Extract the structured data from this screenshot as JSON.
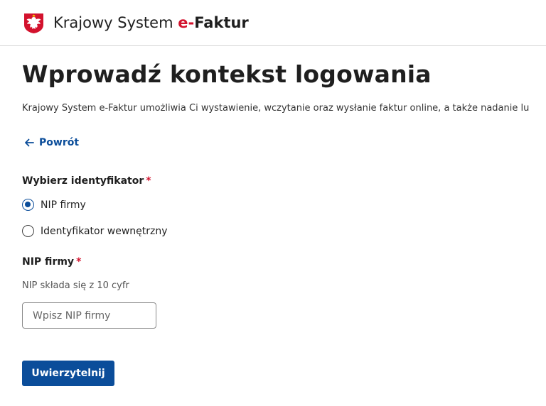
{
  "header": {
    "brand_prefix": "Krajowy System ",
    "brand_accent": "e-",
    "brand_suffix": "Faktur",
    "emblem_icon": "polish-eagle-emblem-icon"
  },
  "page": {
    "title": "Wprowadź kontekst logowania",
    "description": "Krajowy System e-Faktur umożliwia Ci wystawienie, wczytanie oraz wysłanie faktur online, a także nadanie lu"
  },
  "back_link": {
    "label": "Powrót",
    "icon": "arrow-left-icon"
  },
  "identifier": {
    "label": "Wybierz identyfikator",
    "required_mark": "*",
    "options": [
      {
        "label": "NIP firmy",
        "selected": true
      },
      {
        "label": "Identyfikator wewnętrzny",
        "selected": false
      }
    ]
  },
  "nip": {
    "label": "NIP firmy",
    "required_mark": "*",
    "hint": "NIP składa się z 10 cyfr",
    "placeholder": "Wpisz NIP firmy",
    "value": ""
  },
  "submit": {
    "label": "Uwierzytelnij"
  },
  "colors": {
    "primary": "#0b4d9a",
    "accent_red": "#d3122d",
    "text": "#1f1f1f",
    "border": "#d5d5d5"
  }
}
